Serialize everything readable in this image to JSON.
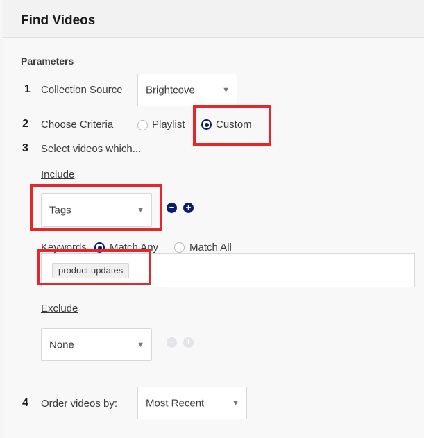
{
  "panel": {
    "title": "Find Videos"
  },
  "parameters": {
    "heading": "Parameters",
    "step1": {
      "num": "1",
      "label": "Collection Source",
      "selected": "Brightcove"
    },
    "step2": {
      "num": "2",
      "label": "Choose Criteria",
      "options": [
        "Playlist",
        "Custom"
      ],
      "selected": "Custom"
    },
    "step3": {
      "num": "3",
      "label": "Select videos which..."
    },
    "include": {
      "heading": "Include",
      "field": "Tags",
      "keywords_label": "Keywords",
      "match_options": [
        "Match Any",
        "Match All"
      ],
      "match_selected": "Match Any",
      "chips": [
        "product updates"
      ]
    },
    "exclude": {
      "heading": "Exclude",
      "field": "None"
    },
    "step4": {
      "num": "4",
      "label": "Order videos by:",
      "selected": "Most Recent"
    }
  },
  "icons": {
    "arrow": "▼",
    "minus": "−",
    "plus": "+"
  },
  "colors": {
    "accent": "#0a1d6b",
    "highlight": "#e5262b"
  }
}
